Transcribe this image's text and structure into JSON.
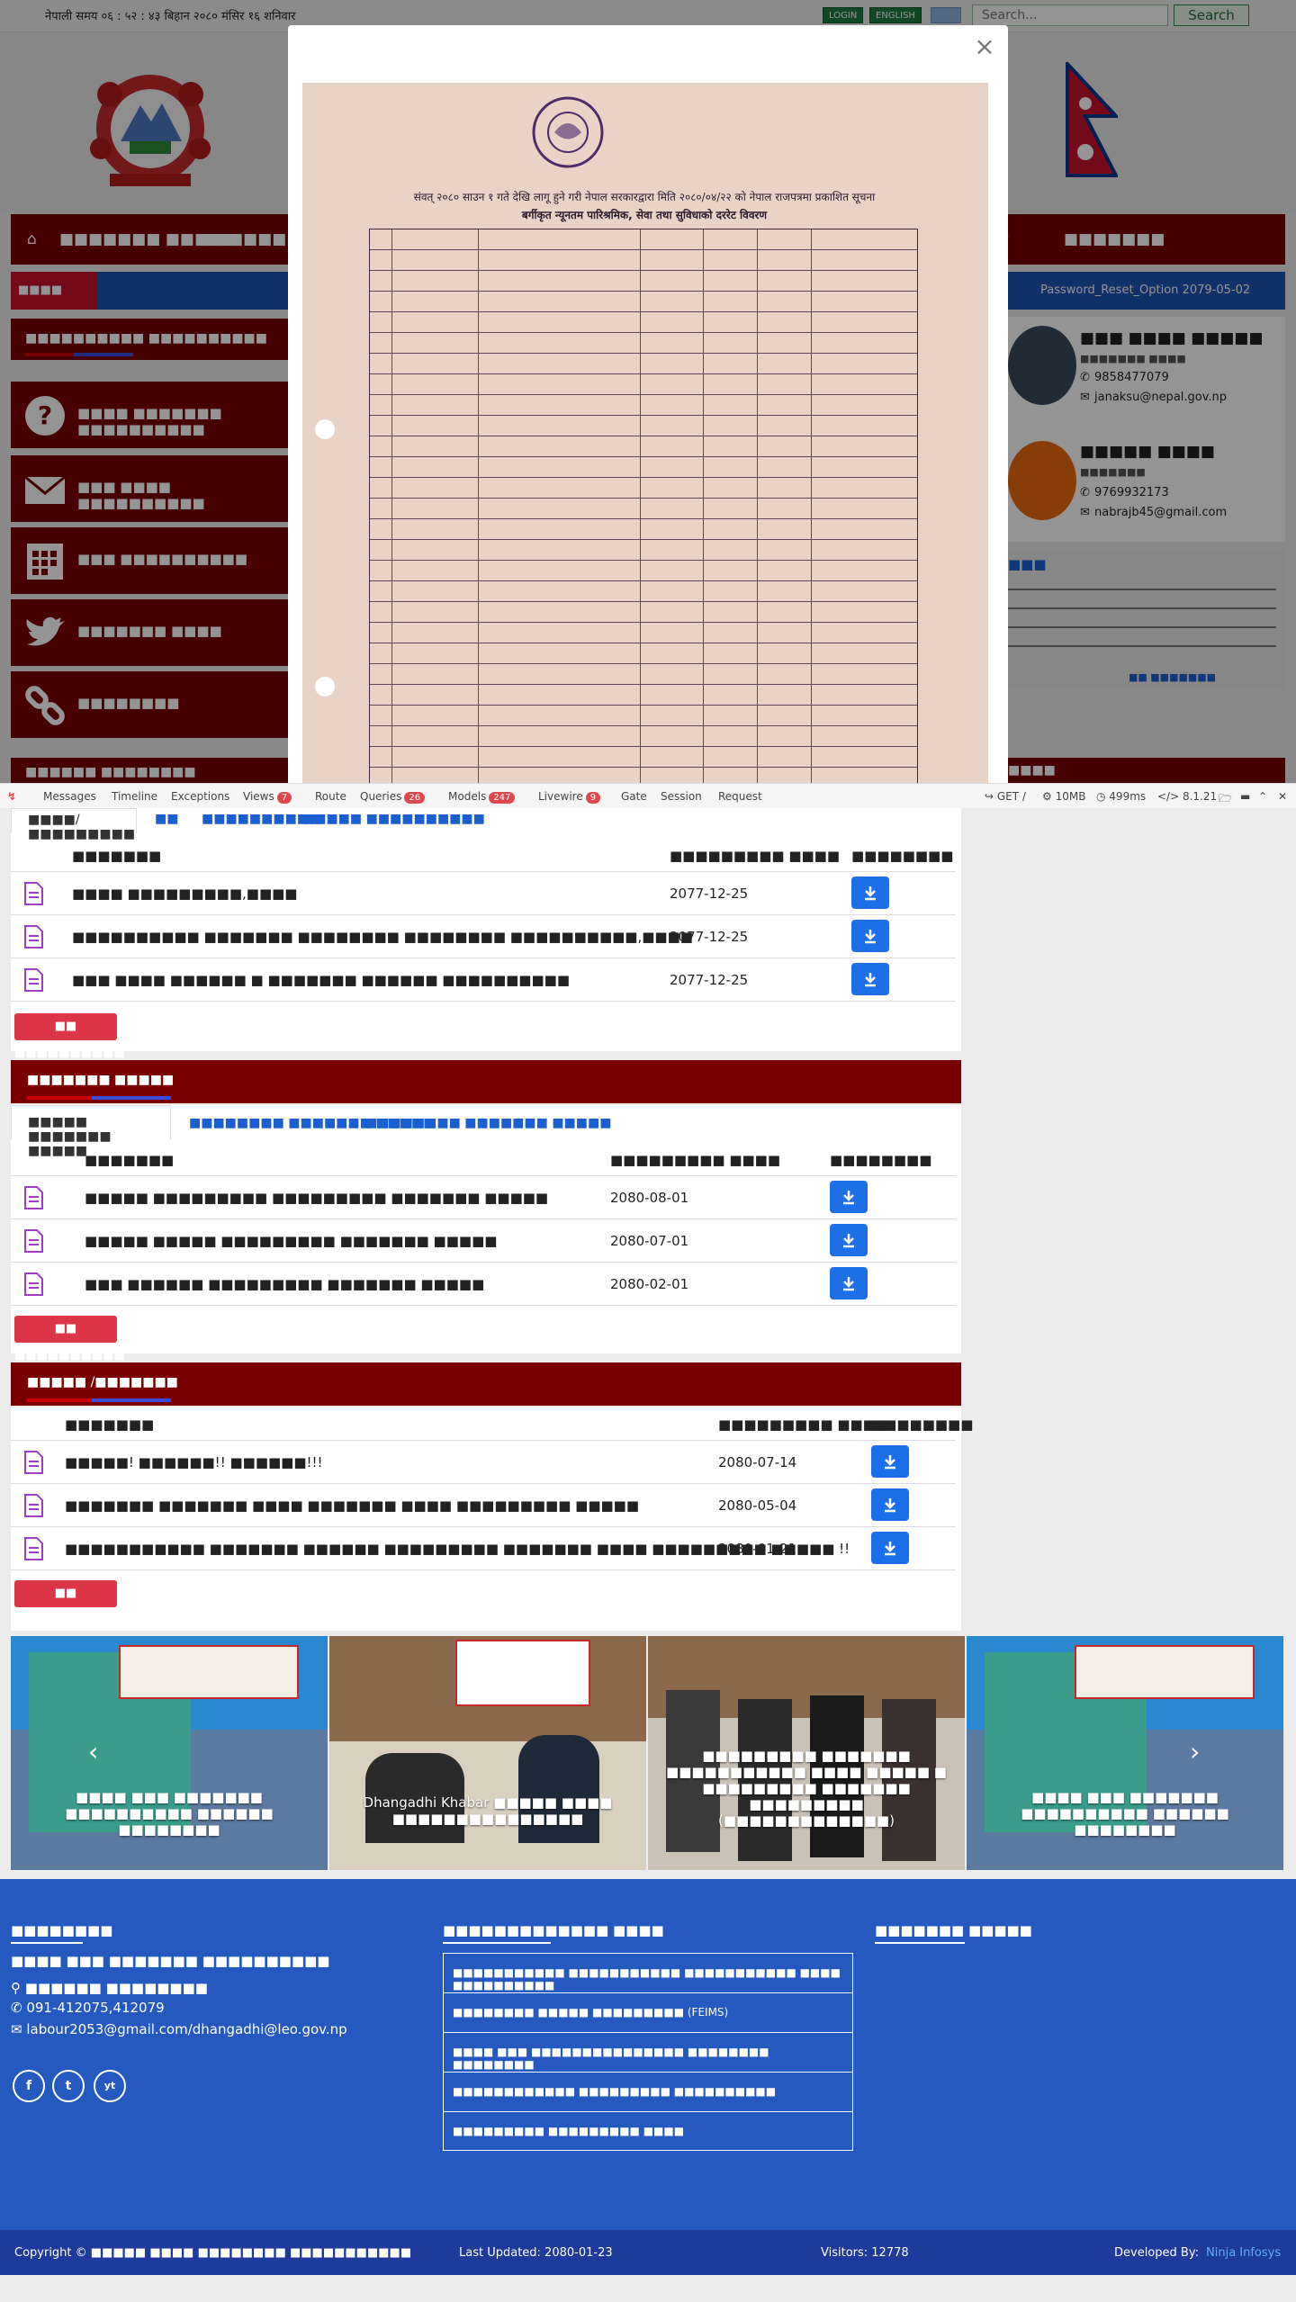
{
  "topbar": {
    "datetime": "नेपाली समय ०६ : ५२ : ४३ बिहान   २०८० मंसिर १६ शनिवार",
    "login": "LOGIN",
    "english": "ENGLISH",
    "search_placeholder": "Search...",
    "search_label": "Search"
  },
  "nav": {
    "items": [
      "■■■■■■■ ■■■■■",
      "■■■■■■■ ■■■"
    ],
    "right_item": "■■■■■■■"
  },
  "ticker": {
    "label": "■■■■ ■■■■",
    "text": "Password_Reset_Option 2079-05-02"
  },
  "left_menu": {
    "heading": "■■■■■■■■■■ ■■■■■■■■■■",
    "cards": [
      "■■■■ ■■■■■■■ ■■■■■■■■■■",
      "■■■ ■■■■ ■■■■■■■■■■",
      "■■■ ■■■■■■■■■■",
      "■■■■■■■ ■■■■",
      "■■■■■■■■"
    ],
    "bottom": "■■■■■■ ■■■■■■■■"
  },
  "officials": [
    {
      "name": "■■■ ■■■■ ■■■■■",
      "role": "■■■■■■■ ■■■■",
      "phone": "9858477079",
      "email": "janaksu@nepal.gov.np"
    },
    {
      "name": "■■■■■ ■■■■",
      "role": "■■■■■■■",
      "phone": "9769932173",
      "email": "nabrajb45@gmail.com"
    }
  ],
  "about": {
    "heading": "■■■",
    "read_more": "■■ ■■■■■■■",
    "right_bottom": "■■■■"
  },
  "modal": {
    "close": "×",
    "doc_title": "संवत् २०८० साउन १ गते देखि लागू हुने गरी नेपाल सरकारद्वारा मिति २०८०/०४/२२ को नेपाल राजपत्रमा प्रकाशित सूचना",
    "doc_subtitle": "बर्गीकृत न्यूनतम पारिश्रमिक, सेवा तथा सुविधाको दररेट विवरण"
  },
  "debugbar": {
    "messages": "Messages",
    "timeline": "Timeline",
    "exceptions": "Exceptions",
    "views": "Views",
    "views_count": "7",
    "route": "Route",
    "queries": "Queries",
    "queries_count": "26",
    "models": "Models",
    "models_count": "247",
    "livewire": "Livewire",
    "livewire_count": "9",
    "gate": "Gate",
    "session": "Session",
    "request": "Request",
    "method": "GET /",
    "memory": "10MB",
    "time": "499ms",
    "php": "8.1.21"
  },
  "section1": {
    "tabs": [
      "■■■■/■■■■■■■■■",
      "■■",
      "■■■■■■■■■■",
      "■■■■■ ■■■■■■■■■■"
    ],
    "col_title": "■■■■■■■",
    "col_date": "■■■■■■■■■ ■■■■",
    "col_dl": "■■■■■■■■",
    "rows": [
      {
        "title": "■■■■ ■■■■■■■■■,■■■■",
        "date": "2077-12-25"
      },
      {
        "title": "■■■■■■■■■■ ■■■■■■■ ■■■■■■■■ ■■■■■■■■ ■■■■■■■■■■,■■■■",
        "date": "2077-12-25"
      },
      {
        "title": "■■■ ■■■■ ■■■■■■ ■ ■■■■■■■ ■■■■■■ ■■■■■■■■■■",
        "date": "2077-12-25"
      }
    ],
    "more": "■■ ■■■■■■■■■■"
  },
  "section2": {
    "heading": "■■■■■■■ ■■■■■",
    "tabs": [
      "■■■■■ ■■■■■■■ ■■■■■",
      "■■■■■■■■ ■■■■■■■ ■■■■■",
      "■■■■■■■■ ■■■■■■■ ■■■■■"
    ],
    "col_title": "■■■■■■■",
    "col_date": "■■■■■■■■■ ■■■■",
    "col_dl": "■■■■■■■■",
    "rows": [
      {
        "title": "■■■■■ ■■■■■■■■■ ■■■■■■■■■ ■■■■■■■ ■■■■■",
        "date": "2080-08-01"
      },
      {
        "title": "■■■■■ ■■■■■ ■■■■■■■■■ ■■■■■■■ ■■■■■",
        "date": "2080-07-01"
      },
      {
        "title": "■■■ ■■■■■■ ■■■■■■■■■ ■■■■■■■ ■■■■■",
        "date": "2080-02-01"
      }
    ],
    "more": "■■ ■■■■■■■■■■"
  },
  "section3": {
    "heading": "■■■■■ /■■■■■■■",
    "col_title": "■■■■■■■",
    "col_date": "■■■■■■■■■ ■■■■",
    "col_dl": "■■■■■■■■",
    "rows": [
      {
        "title": "■■■■■! ■■■■■■!! ■■■■■■!!!",
        "date": "2080-07-14"
      },
      {
        "title": "■■■■■■■ ■■■■■■■ ■■■■ ■■■■■■■ ■■■■ ■■■■■■■■■ ■■■■■",
        "date": "2080-05-04"
      },
      {
        "title": "■■■■■■■■■■■ ■■■■■■■ ■■■■■■ ■■■■■■■■■ ■■■■■■■ ■■■■ ■■■■■■■■■ ■■■■■ !!",
        "date": "2080-01-21"
      }
    ],
    "more": "■■ ■■■■■■■■■■"
  },
  "gallery": [
    {
      "caption": "■■■■ ■■■ ■■■■■■■ ■■■■■■■■■■ ■■■■■■ ■■■■■■■■"
    },
    {
      "caption": "Dhangadhi Khabar ■■■■■ ■■■■ ■■■■■■■■■■■■■■■"
    },
    {
      "caption": "■■■■■■■■■ ■■■■■■■ ■■■■■■■■■■■ ■■■■ ■■■■■ ■ ■■■■■■■■■ ■■■■■■■ ■■■■■■■■■ (■■■■■■■■■■■■■)"
    },
    {
      "caption": "■■■■ ■■■ ■■■■■■■ ■■■■■■■■■■ ■■■■■■ ■■■■■■■■"
    }
  ],
  "footer": {
    "contact_heading": "■■■■■■■■",
    "office": "■■■■ ■■■ ■■■■■■■ ■■■■■■■■■■",
    "address": "■■■■■■ ■■■■■■■■",
    "phone": "091-412075,412079",
    "email": "labour2053@gmail.com/dhangadhi@leo.gov.np",
    "social": [
      "f",
      "t",
      "yt"
    ],
    "links_heading": "■■■■■■■■■■■■■ ■■■■",
    "links": [
      "■■■■■■■■■■■ ■■■■■■■■■■■ ■■■■■■■■■■■ ■■■■ ■■■■■■■■■■",
      "■■■■■■■■ ■■■■■ ■■■■■■■■■ (FEIMS)",
      "■■■■ ■■■ ■■■■■■■■■■■■■■■ ■■■■■■■■ ■■■■■■■■",
      "■■■■■■■■■■■■ ■■■■■■■■■ ■■■■■■■■■■",
      "■■■■■■■■■ ■■■■■■■■■ ■■■■"
    ],
    "third_heading": "■■■■■■■ ■■■■■",
    "copyright": "Copyright © ■■■■■ ■■■■ ■■■■■■■■ ■■■■■■■■■■■",
    "last_updated": "Last Updated: 2080-01-23",
    "visitors": "Visitors: 12778",
    "developed_label": "Developed By:",
    "developer": "Ninja Infosys"
  },
  "colors": {
    "maroon": "#7a0000",
    "footer_blue": "#2559bf",
    "copyright_blue": "#1e3a9a",
    "button_blue": "#1d6fe8",
    "more_red": "#dc3545"
  }
}
